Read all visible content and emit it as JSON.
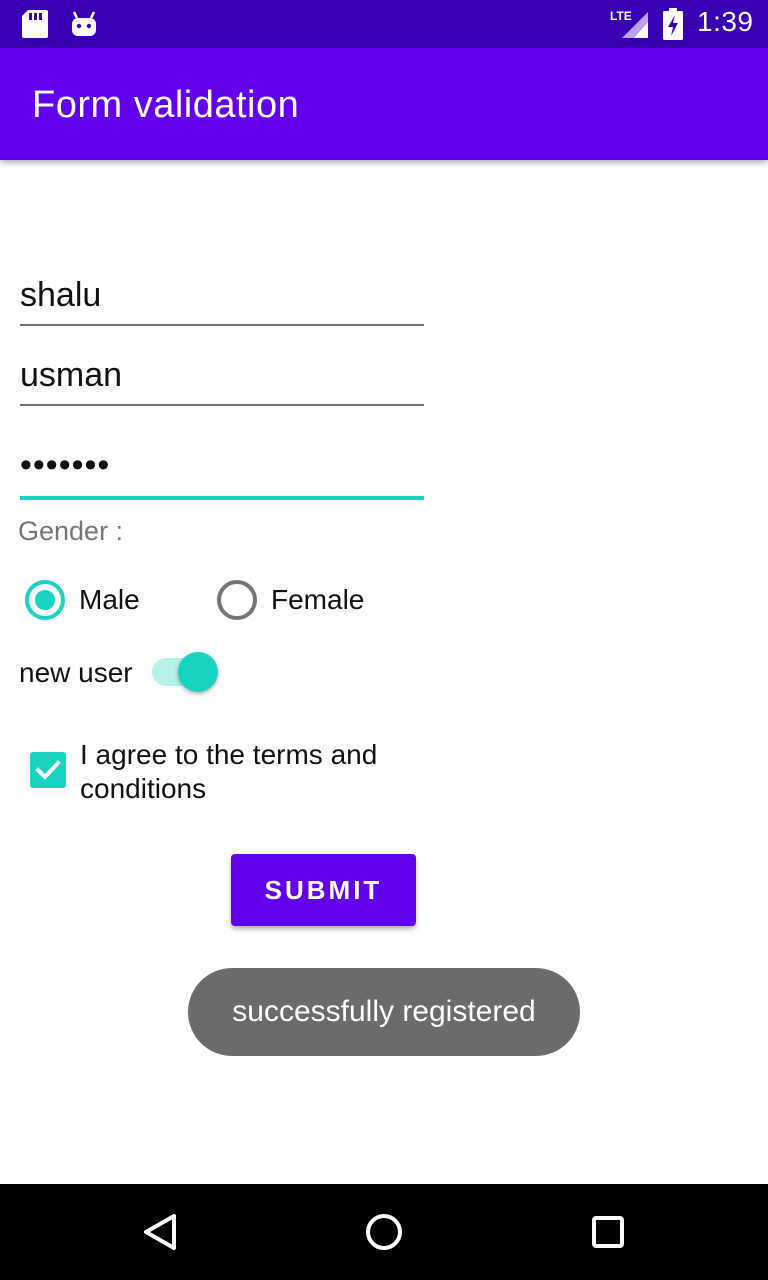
{
  "status_bar": {
    "time": "1:39",
    "network": "LTE",
    "icons": [
      "sd-card-icon",
      "android-icon",
      "lte-signal-icon",
      "battery-charging-icon"
    ]
  },
  "app_bar": {
    "title": "Form validation"
  },
  "form": {
    "first_name": "shalu",
    "last_name": "usman",
    "password": "•••••••",
    "gender_label": "Gender :",
    "gender_options": [
      {
        "label": "Male",
        "checked": true
      },
      {
        "label": "Female",
        "checked": false
      }
    ],
    "new_user_label": "new user",
    "new_user_on": true,
    "terms_label": "I agree to the terms and conditions",
    "terms_checked": true,
    "submit_label": "SUBMIT"
  },
  "toast": {
    "message": "successfully registered"
  },
  "nav_bar": {
    "icons": [
      "back-icon",
      "home-icon",
      "recents-icon"
    ]
  },
  "colors": {
    "primary": "#6200ee",
    "primary_dark": "#3700b3",
    "accent": "#18d3c0",
    "toast_bg": "#6b6b6b"
  }
}
